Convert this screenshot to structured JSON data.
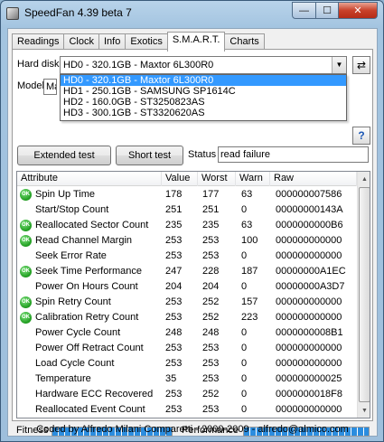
{
  "window": {
    "title": "SpeedFan 4.39 beta 7",
    "minimize_glyph": "—",
    "maximize_glyph": "☐",
    "close_glyph": "✕"
  },
  "tabs": [
    "Readings",
    "Clock",
    "Info",
    "Exotics",
    "S.M.A.R.T.",
    "Charts"
  ],
  "active_tab": "S.M.A.R.T.",
  "smart": {
    "hard_disk_label": "Hard disk",
    "selected_disk": "HD0 - 320.1GB - Maxtor 6L300R0",
    "disk_options": [
      "HD0 - 320.1GB - Maxtor 6L300R0",
      "HD1 - 250.1GB - SAMSUNG SP1614C",
      "HD2 - 160.0GB - ST3250823AS",
      "HD3 - 300.1GB - ST3320620AS"
    ],
    "model_label": "Model",
    "model_value": "Ma",
    "help_glyph": "?",
    "refresh_glyph": "⇄",
    "extended_test_label": "Extended test",
    "short_test_label": "Short test",
    "status_label": "Status",
    "status_value": "read failure",
    "columns": [
      "Attribute",
      "Value",
      "Worst",
      "Warn",
      "Raw"
    ],
    "rows": [
      {
        "ok": true,
        "attribute": "Spin Up Time",
        "value": "178",
        "worst": "177",
        "warn": "63",
        "raw": "000000007586"
      },
      {
        "ok": false,
        "attribute": "Start/Stop Count",
        "value": "251",
        "worst": "251",
        "warn": "0",
        "raw": "00000000143A"
      },
      {
        "ok": true,
        "attribute": "Reallocated Sector Count",
        "value": "235",
        "worst": "235",
        "warn": "63",
        "raw": "0000000000B6"
      },
      {
        "ok": true,
        "attribute": "Read Channel Margin",
        "value": "253",
        "worst": "253",
        "warn": "100",
        "raw": "000000000000"
      },
      {
        "ok": false,
        "attribute": "Seek Error Rate",
        "value": "253",
        "worst": "253",
        "warn": "0",
        "raw": "000000000000"
      },
      {
        "ok": true,
        "attribute": "Seek Time Performance",
        "value": "247",
        "worst": "228",
        "warn": "187",
        "raw": "00000000A1EC"
      },
      {
        "ok": false,
        "attribute": "Power On Hours Count",
        "value": "204",
        "worst": "204",
        "warn": "0",
        "raw": "00000000A3D7"
      },
      {
        "ok": true,
        "attribute": "Spin Retry Count",
        "value": "253",
        "worst": "252",
        "warn": "157",
        "raw": "000000000000"
      },
      {
        "ok": true,
        "attribute": "Calibration Retry Count",
        "value": "253",
        "worst": "252",
        "warn": "223",
        "raw": "000000000000"
      },
      {
        "ok": false,
        "attribute": "Power Cycle Count",
        "value": "248",
        "worst": "248",
        "warn": "0",
        "raw": "0000000008B1"
      },
      {
        "ok": false,
        "attribute": "Power Off Retract Count",
        "value": "253",
        "worst": "253",
        "warn": "0",
        "raw": "000000000000"
      },
      {
        "ok": false,
        "attribute": "Load Cycle Count",
        "value": "253",
        "worst": "253",
        "warn": "0",
        "raw": "000000000000"
      },
      {
        "ok": false,
        "attribute": "Temperature",
        "value": "35",
        "worst": "253",
        "warn": "0",
        "raw": "000000000025"
      },
      {
        "ok": false,
        "attribute": "Hardware ECC Recovered",
        "value": "253",
        "worst": "252",
        "warn": "0",
        "raw": "0000000018F8"
      },
      {
        "ok": false,
        "attribute": "Reallocated Event Count",
        "value": "253",
        "worst": "253",
        "warn": "0",
        "raw": "000000000000"
      }
    ],
    "ok_badge": "OK",
    "fitness_label": "Fitness",
    "fitness_level": 1.0,
    "performance_label": "Performance",
    "performance_level": 1.0
  },
  "footer": "Coded by Alfredo Milani Comparetti - 2000-2009 - alfredo@almico.com",
  "colors": {
    "ok": "#1e9b1e",
    "selection": "#3399ff",
    "meter": "#2b8ddf"
  },
  "icons": {
    "ok": "ok-status-icon",
    "refresh": "refresh-icon",
    "help": "help-icon"
  }
}
